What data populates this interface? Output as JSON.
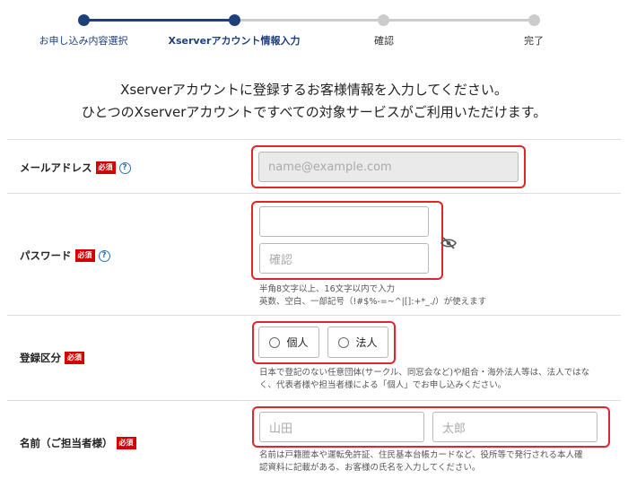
{
  "progress": {
    "steps": [
      {
        "label": "お申し込み内容選択",
        "state": "done"
      },
      {
        "label": "Xserverアカウント情報入力",
        "state": "current"
      },
      {
        "label": "確認",
        "state": "todo"
      },
      {
        "label": "完了",
        "state": "todo"
      }
    ],
    "colors": {
      "active": "#1d3f7a",
      "inactive": "#cccccc",
      "label_active": "#1d3f7a",
      "label_inactive": "#333333"
    }
  },
  "intro": {
    "line1": "Xserverアカウントに登録するお客様情報を入力してください。",
    "line2": "ひとつのXserverアカウントですべての対象サービスがご利用いただけます。"
  },
  "form": {
    "required_badge": "必須",
    "help_symbol": "?",
    "email": {
      "label": "メールアドレス",
      "placeholder": "name@example.com"
    },
    "password": {
      "label": "パスワード",
      "value": "",
      "confirm_placeholder": "確認",
      "note_line1": "半角8文字以上、16文字以内で入力",
      "note_line2": "英数、空白、一部記号（!#$%-=~^|[]:+*_./）が使えます",
      "toggle_icon": "eye-slash-icon"
    },
    "registration_type": {
      "label": "登録区分",
      "options": [
        "個人",
        "法人"
      ],
      "note_line1": "日本で登記のない任意団体(サークル、同窓会など)や組合・海外法人等は、法人ではな",
      "note_line2": "く、代表者様や担当者様による「個人」でお申し込みください。"
    },
    "name": {
      "label": "名前（ご担当者様）",
      "last_placeholder": "山田",
      "first_placeholder": "太郎",
      "note_line1": "名前は戸籍謄本や運転免許証、住民基本台帳カードなど、役所等で発行される本人確",
      "note_line2": "認資料に記載がある、お客様の氏名を入力してください。"
    }
  }
}
